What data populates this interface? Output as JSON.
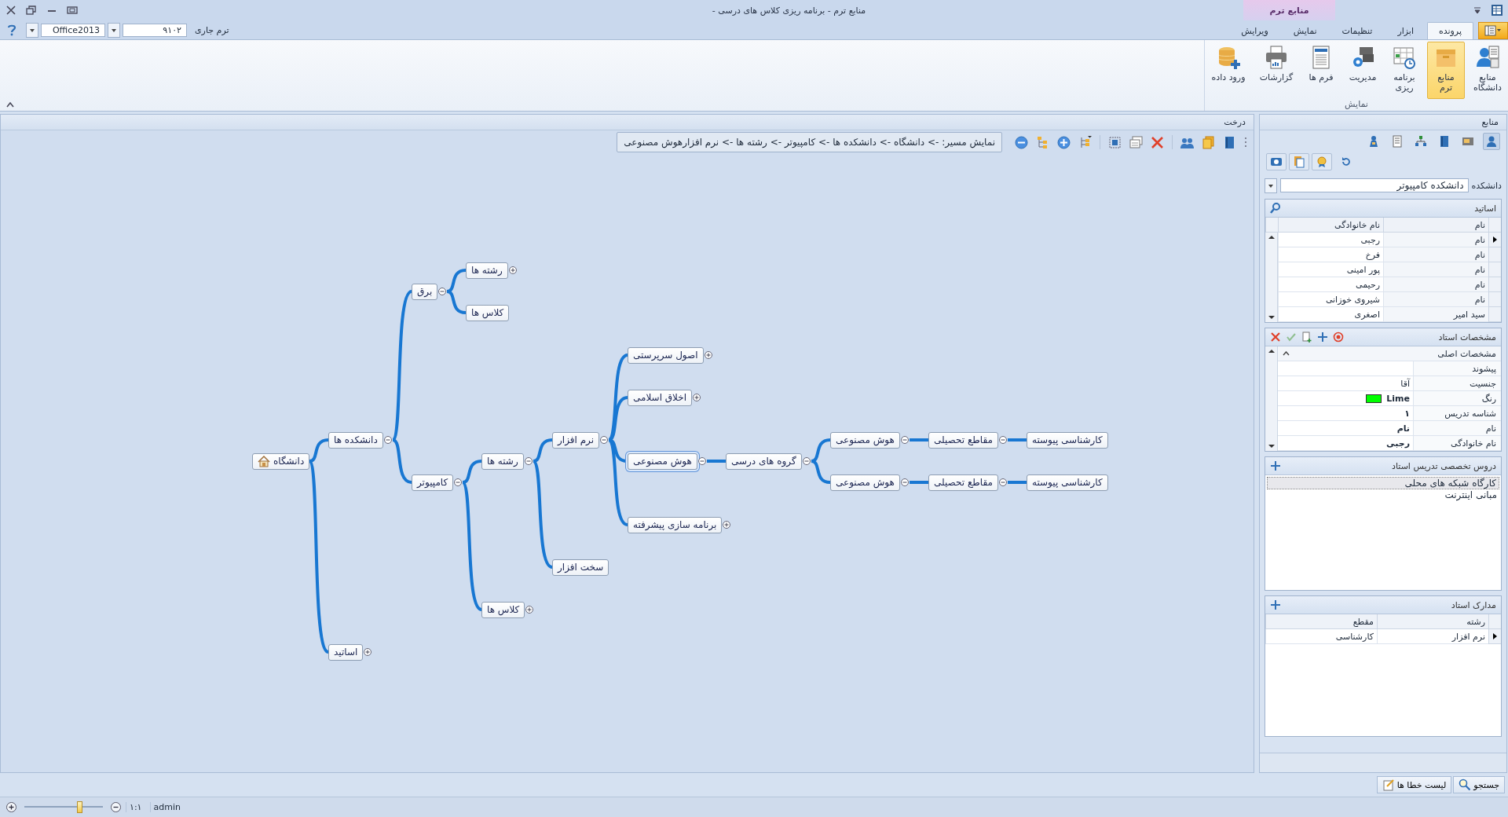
{
  "window": {
    "title": "منابع ترم - برنامه ریزی کلاس های درسی -"
  },
  "term_bar": {
    "theme_value": "Office2013",
    "term_value": "۹۱۰۲",
    "term_label": "ترم جاری"
  },
  "ribbon": {
    "context_tab": "منابع ترم",
    "tabs": [
      {
        "label": "پرونده",
        "selected": true
      },
      {
        "label": "ابزار",
        "selected": false
      },
      {
        "label": "تنظیمات",
        "selected": false
      },
      {
        "label": "نمایش",
        "selected": false
      },
      {
        "label": "ویرایش",
        "selected": false
      }
    ],
    "buttons": [
      {
        "kind": "university",
        "label": "منابع\nدانشگاه",
        "selected": false
      },
      {
        "kind": "term",
        "label": "منابع\nترم",
        "selected": true
      },
      {
        "kind": "schedule",
        "label": "برنامه\nریزی",
        "selected": false
      },
      {
        "kind": "manage",
        "label": "مدیریت",
        "selected": false
      },
      {
        "kind": "forms",
        "label": "فرم ها",
        "selected": false
      },
      {
        "kind": "reports",
        "label": "گزارشات",
        "selected": false
      },
      {
        "kind": "import",
        "label": "ورود داده",
        "selected": false
      }
    ],
    "group_label": "نمایش"
  },
  "tree_panel": {
    "title": "درخت",
    "path": "نمایش مسیر: -> دانشگاه -> دانشکده ها -> کامپیوتر -> رشته ها -> نرم افزارهوش مصنوعی",
    "root": {
      "label": "دانشگاه",
      "selected": false,
      "children": [
        {
          "label": "دانشکده ها",
          "kind": "open",
          "selected": false,
          "children": [
            {
              "label": "برق",
              "kind": "open",
              "selected": false,
              "children": [
                {
                  "label": "رشته ها",
                  "kind": "closed",
                  "selected": false
                },
                {
                  "label": "کلاس ها",
                  "selected": false
                }
              ]
            },
            {
              "label": "کامپیوتر",
              "kind": "open",
              "selected": false,
              "children": [
                {
                  "label": "رشته ها",
                  "kind": "open",
                  "selected": false,
                  "children": [
                    {
                      "label": "نرم افزار",
                      "kind": "open",
                      "selected": false,
                      "children": [
                        {
                          "label": "اصول سرپرستی",
                          "kind": "closed",
                          "selected": false
                        },
                        {
                          "label": "اخلاق اسلامی",
                          "kind": "closed",
                          "selected": false
                        },
                        {
                          "label": "هوش مصنوعی",
                          "kind": "open",
                          "selected": true,
                          "children": [
                            {
                              "label": "گروه های درسی",
                              "kind": "open",
                              "selected": false,
                              "children": [
                                {
                                  "label": "هوش مصنوعی",
                                  "kind": "open",
                                  "selected": false,
                                  "children": [
                                    {
                                      "label": "مقاطع تحصیلی",
                                      "kind": "open",
                                      "selected": false,
                                      "children": [
                                        {
                                          "label": "کارشناسی پیوسته",
                                          "selected": false
                                        }
                                      ]
                                    }
                                  ]
                                },
                                {
                                  "label": "هوش مصنوعی",
                                  "kind": "open",
                                  "selected": false,
                                  "children": [
                                    {
                                      "label": "مقاطع تحصیلی",
                                      "kind": "open",
                                      "selected": false,
                                      "children": [
                                        {
                                          "label": "کارشناسی پیوسته",
                                          "selected": false
                                        }
                                      ]
                                    }
                                  ]
                                }
                              ]
                            }
                          ]
                        },
                        {
                          "label": "برنامه سازی پیشرفته",
                          "kind": "closed",
                          "selected": false
                        }
                      ]
                    },
                    {
                      "label": "سخت افزار",
                      "selected": false
                    }
                  ]
                },
                {
                  "label": "کلاس ها",
                  "kind": "closed",
                  "selected": false
                }
              ]
            }
          ]
        },
        {
          "label": "اساتید",
          "kind": "closed",
          "selected": false
        }
      ]
    }
  },
  "resources_panel": {
    "title": "منابع",
    "tools": [
      {
        "kind": "teacher",
        "selected": true
      },
      {
        "kind": "room",
        "selected": false
      },
      {
        "kind": "book",
        "selected": false
      },
      {
        "kind": "org",
        "selected": false
      },
      {
        "kind": "doc",
        "selected": false
      },
      {
        "kind": "badge",
        "selected": false
      }
    ],
    "faculty_label": "دانشکده",
    "faculty_value": "دانشکده کامپیوتر",
    "teachers": {
      "title": "اساتید",
      "columns": [
        "نام",
        "نام خانوادگی"
      ],
      "rows": [
        {
          "cells": [
            "نام",
            "رجبی"
          ],
          "selected": true
        },
        {
          "cells": [
            "نام",
            "فرخ"
          ],
          "selected": false
        },
        {
          "cells": [
            "نام",
            "پور امینی"
          ],
          "selected": false
        },
        {
          "cells": [
            "نام",
            "رحیمی"
          ],
          "selected": false
        },
        {
          "cells": [
            "نام",
            "شیروی خوزانی"
          ],
          "selected": false
        },
        {
          "cells": [
            "سید امیر",
            "اصغری"
          ],
          "selected": false
        }
      ]
    },
    "details": {
      "title": "مشخصات استاد",
      "category": "مشخصات اصلی",
      "properties": [
        {
          "label": "پیشوند"
        },
        {
          "label": "جنسیت",
          "value": "آقا",
          "bold": false
        },
        {
          "label": "رنگ",
          "value": "Lime",
          "bold": true,
          "color": "#00ff00"
        },
        {
          "label": "شناسه تدریس",
          "value": "۱",
          "bold": true
        },
        {
          "label": "نام",
          "value": "نام",
          "bold": true
        },
        {
          "label": "نام خانوادگی",
          "value": "رجبی",
          "bold": true
        }
      ]
    },
    "courses": {
      "title": "دروس تخصصی تدریس استاد",
      "items": [
        {
          "label": "کارگاه شبکه های محلی",
          "selected": true
        },
        {
          "label": "مبانی اینترنت",
          "selected": false
        }
      ]
    },
    "documents": {
      "title": "مدارک استاد",
      "columns": [
        "رشته",
        "مقطع"
      ],
      "rows": [
        {
          "cells": [
            "نرم افزار",
            "کارشناسی"
          ],
          "selected": true
        }
      ]
    }
  },
  "bottom_buttons": [
    "جستجو",
    "لیست خطا ها"
  ],
  "status": {
    "zoom": {
      "level": 0.7
    },
    "ratio": "۱:۱",
    "user": "admin"
  }
}
